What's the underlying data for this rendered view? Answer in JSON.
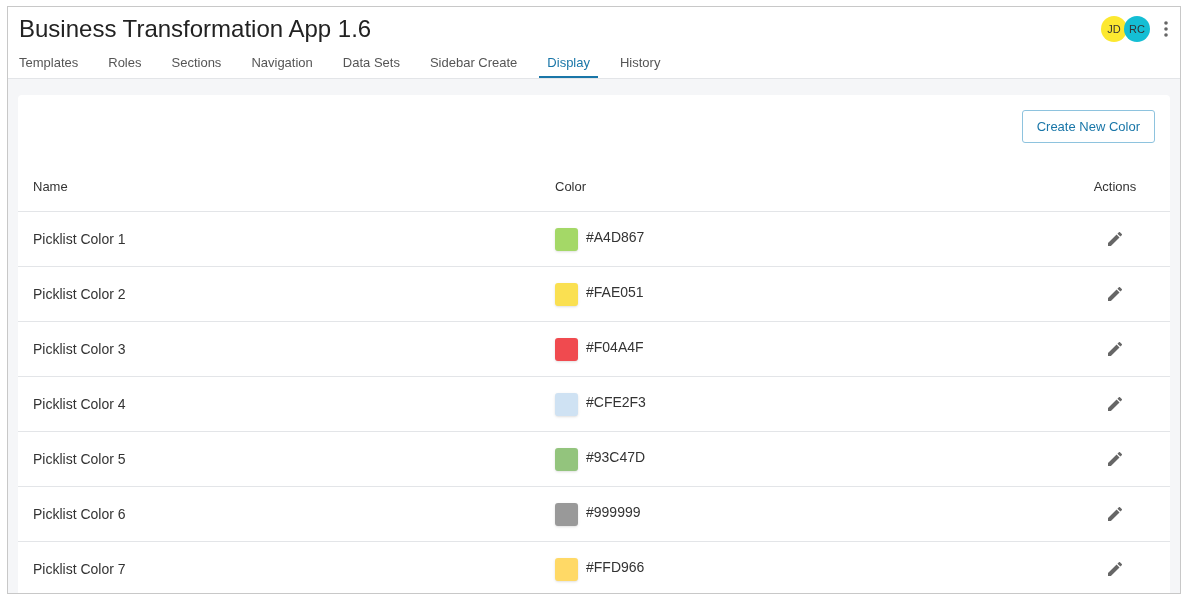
{
  "window": {
    "title": "Business Transformation App 1.6"
  },
  "avatars": [
    {
      "initials": "JD",
      "color": "#fce830"
    },
    {
      "initials": "RC",
      "color": "#14bed4"
    }
  ],
  "tabs": [
    {
      "label": "Templates",
      "selected": false
    },
    {
      "label": "Roles",
      "selected": false
    },
    {
      "label": "Sections",
      "selected": false
    },
    {
      "label": "Navigation",
      "selected": false
    },
    {
      "label": "Data Sets",
      "selected": false
    },
    {
      "label": "Sidebar Create",
      "selected": false
    },
    {
      "label": "Display",
      "selected": true
    },
    {
      "label": "History",
      "selected": false
    }
  ],
  "create_button": "Create New Color",
  "table": {
    "columns": [
      "Name",
      "Color",
      "Actions"
    ],
    "rows": [
      {
        "name": "Picklist Color 1",
        "color": "#a4d867",
        "value": "#A4D867"
      },
      {
        "name": "Picklist Color 2",
        "color": "#fae051",
        "value": "#FAE051"
      },
      {
        "name": "Picklist Color 3",
        "color": "#f04a4f",
        "value": "#F04A4F"
      },
      {
        "name": "Picklist Color 4",
        "color": "#cfe2f3",
        "value": "#CFE2F3"
      },
      {
        "name": "Picklist Color 5",
        "color": "#93c47d",
        "value": "#93C47D"
      },
      {
        "name": "Picklist Color 6",
        "color": "#999999",
        "value": "#999999"
      },
      {
        "name": "Picklist Color 7",
        "color": "#ffd966",
        "value": "#FFD966"
      }
    ]
  }
}
